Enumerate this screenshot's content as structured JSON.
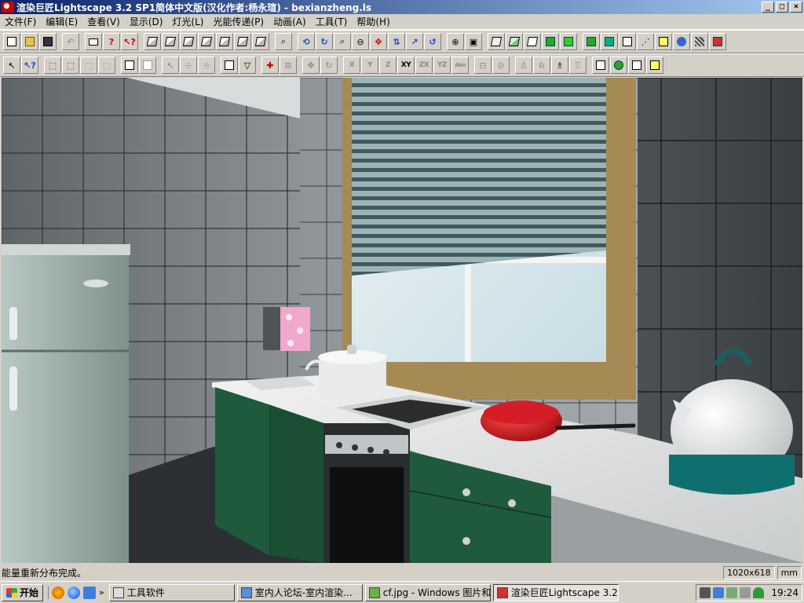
{
  "window": {
    "title": "渲染巨匠Lightscape 3.2 SP1简体中文版(汉化作者:杨永瑄) - bexianzheng.ls",
    "minimize": "_",
    "maximize": "□",
    "close": "×"
  },
  "menu": [
    "文件(F)",
    "编辑(E)",
    "查看(V)",
    "显示(D)",
    "灯光(L)",
    "光能传递(P)",
    "动画(A)",
    "工具(T)",
    "帮助(H)"
  ],
  "toolbar2_labels": {
    "x": "X",
    "y": "Y",
    "z": "Z",
    "xy": "XY",
    "zx": "ZX",
    "yz": "YZ",
    "aim": "Aim"
  },
  "status": {
    "message": "能量重新分布完成。",
    "resolution": "1020x618",
    "units": "mm"
  },
  "taskbar": {
    "start": "开始",
    "chevron": "»",
    "tasks": [
      {
        "label": "工具软件"
      },
      {
        "label": "室内人论坛-室内渲染..."
      },
      {
        "label": "cf.jpg - Windows 图片和..."
      },
      {
        "label": "渲染巨匠Lightscape 3.2..."
      }
    ],
    "clock": "19:24"
  },
  "colors": {
    "titlebar_start": "#0a246a",
    "titlebar_end": "#a6caf0",
    "chrome": "#d4d0c8",
    "cabinet_green": "#1f5a3c",
    "fridge": "#9aaba6",
    "pan_red": "#c8101c"
  }
}
